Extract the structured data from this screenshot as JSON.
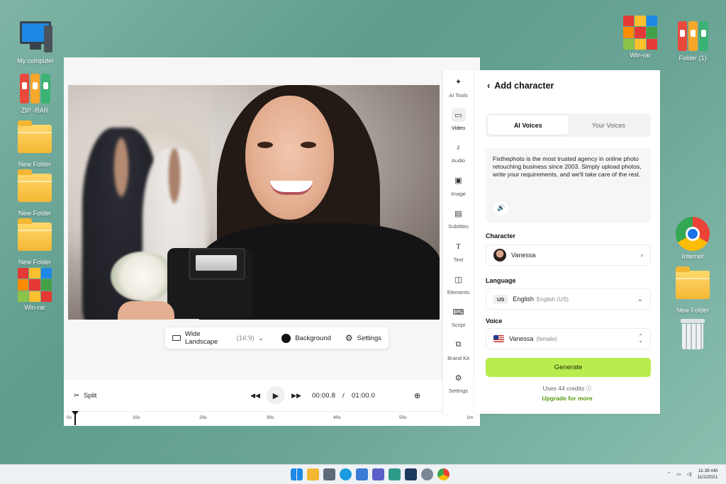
{
  "desktop": {
    "left_icons": [
      {
        "label": "My computer",
        "icon": "computer-icon"
      },
      {
        "label": "ZIP -RAR",
        "icon": "archive-books-icon"
      },
      {
        "label": "New Folder",
        "icon": "folder-icon"
      },
      {
        "label": "New Folder",
        "icon": "folder-icon"
      },
      {
        "label": "New Folder",
        "icon": "folder-icon"
      },
      {
        "label": "Win-rar",
        "icon": "winrar-icon"
      }
    ],
    "right_icons": [
      {
        "label": "Win-rar",
        "icon": "winrar-icon"
      },
      {
        "label": "Folder (1)",
        "icon": "archive-books-icon"
      },
      {
        "label": "Internet",
        "icon": "chrome-icon"
      },
      {
        "label": "New Folder",
        "icon": "folder-icon"
      },
      {
        "label": "",
        "icon": "recycle-bin-icon"
      }
    ]
  },
  "editor": {
    "canvas_toolbar": {
      "aspect_label": "Wide Landscape",
      "aspect_ratio": "(16:9)",
      "background_label": "Background",
      "settings_label": "Settings"
    },
    "timeline": {
      "split_label": "Split",
      "current_time": "00:00.8",
      "separator": "/",
      "total_time": "01:00.0",
      "ticks": [
        "0s",
        "10s",
        "20s",
        "30s",
        "40s",
        "50s",
        "1m"
      ]
    },
    "tools": [
      {
        "label": "AI Tools",
        "icon": "sparkle-icon",
        "active": false
      },
      {
        "label": "Video",
        "icon": "video-icon",
        "active": true
      },
      {
        "label": "Audio",
        "icon": "music-note-icon",
        "active": false
      },
      {
        "label": "Image",
        "icon": "image-icon",
        "active": false
      },
      {
        "label": "Subtitles",
        "icon": "subtitles-icon",
        "active": false
      },
      {
        "label": "Text",
        "icon": "text-icon",
        "active": false
      },
      {
        "label": "Elements",
        "icon": "elements-icon",
        "active": false
      },
      {
        "label": "Script",
        "icon": "script-icon",
        "active": false
      },
      {
        "label": "Brand Kit",
        "icon": "brand-kit-icon",
        "active": false
      },
      {
        "label": "Settings",
        "icon": "gear-icon",
        "active": false
      }
    ]
  },
  "panel": {
    "title": "Add character",
    "tabs": [
      {
        "label": "AI Voices",
        "active": true
      },
      {
        "label": "Your Voices",
        "active": false
      }
    ],
    "script_text": "Fixthephoto is the most trusted agency in online photo retouching business since 2003. Simply upload photos, write your requirements, and we'll take care of the rest.",
    "character_label": "Character",
    "character_value": "Vanessa",
    "language_label": "Language",
    "language_code": "US",
    "language_value": "English",
    "language_sub": "English (US)",
    "voice_label": "Voice",
    "voice_value": "Vanessa",
    "voice_sub": "(female)",
    "generate_label": "Generate",
    "credits_text": "Uses 44 credits",
    "upgrade_text": "Upgrade for more"
  },
  "taskbar": {
    "time": "11:39 AM",
    "date": "11/2/2021"
  },
  "colors": {
    "accent_green": "#b8ec4f",
    "link_green": "#5a9a12",
    "desktop_teal": "#6aa495"
  }
}
